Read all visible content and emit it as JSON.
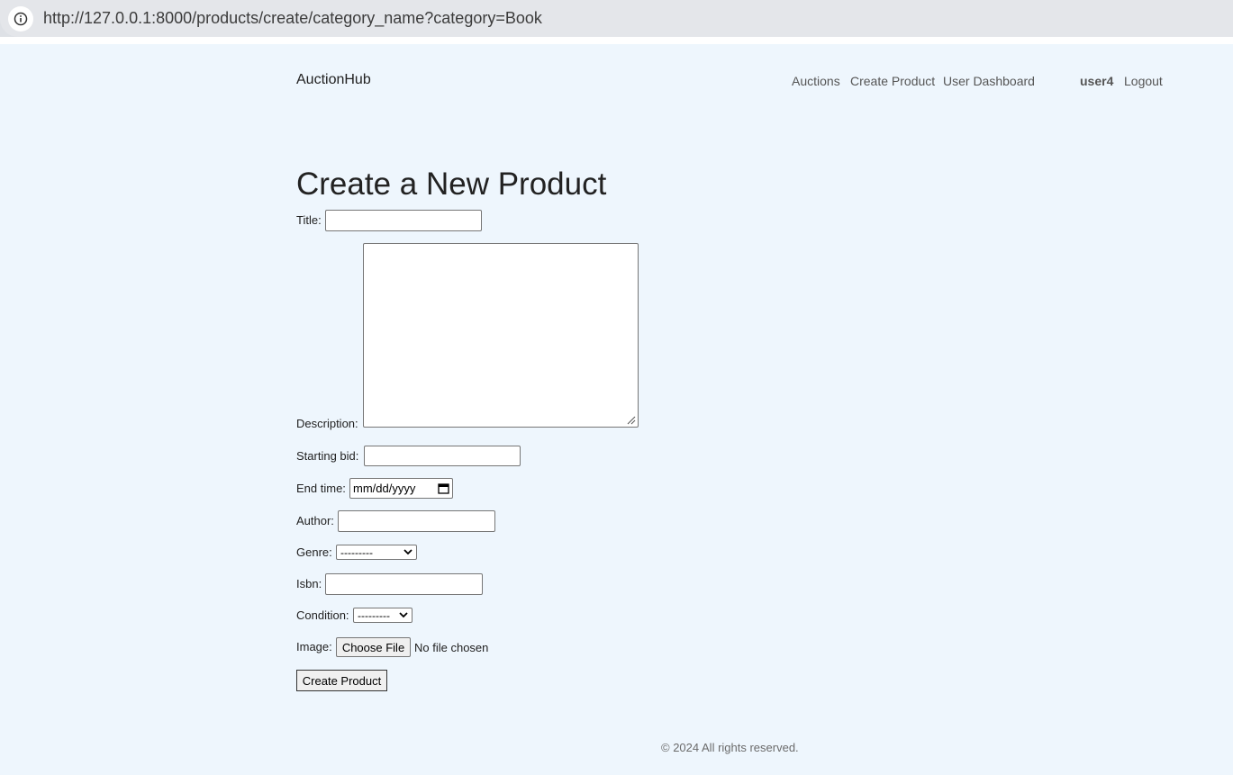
{
  "browser": {
    "url": "http://127.0.0.1:8000/products/create/category_name?category=Book"
  },
  "header": {
    "brand": "AuctionHub",
    "nav": [
      "Auctions",
      "Create Product",
      "User Dashboard"
    ],
    "username": "user4",
    "logout": "Logout"
  },
  "form": {
    "heading": "Create a New Product",
    "labels": {
      "title": "Title:",
      "description": "Description:",
      "starting_bid": "Starting bid:",
      "end_time": "End time:",
      "author": "Author:",
      "genre": "Genre:",
      "isbn": "Isbn:",
      "condition": "Condition:",
      "image": "Image:"
    },
    "values": {
      "title": "",
      "description": "",
      "starting_bid": "",
      "end_time_placeholder": "mm/dd/yyyy",
      "author": "",
      "genre_selected": "---------",
      "isbn": "",
      "condition_selected": "---------"
    },
    "choose_file_label": "Choose File",
    "no_file_text": "No file chosen",
    "submit_label": "Create Product"
  },
  "footer": {
    "text": "© 2024 All rights reserved."
  },
  "icons": {
    "info": "info-icon",
    "calendar": "calendar-icon",
    "chevron": "chevron-down-icon",
    "resize": "resize-grip-icon"
  }
}
